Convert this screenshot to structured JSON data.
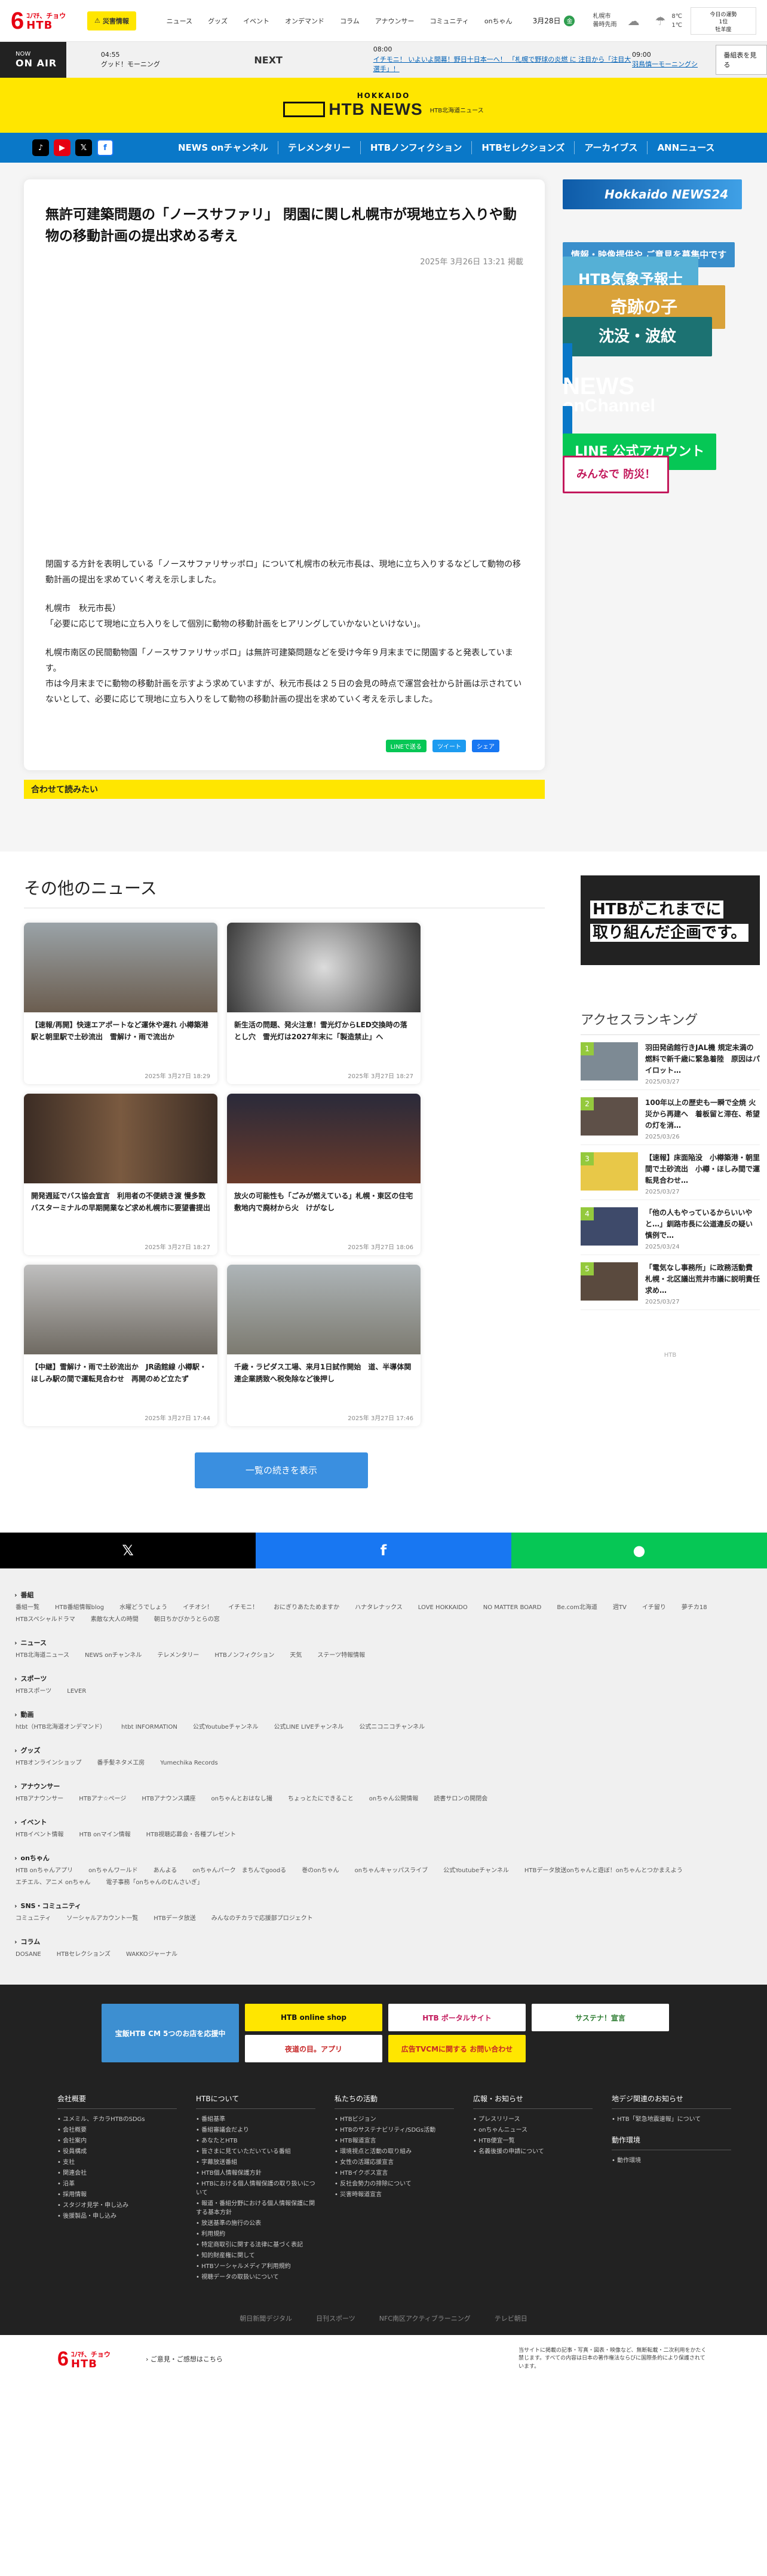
{
  "header": {
    "logo_num": "6",
    "logo_top": "ｺﾉﾏﾁ、チョウ",
    "logo_brand": "HTB",
    "disaster_label": "災害情報",
    "nav": [
      "ニュース",
      "グッズ",
      "イベント",
      "オンデマンド",
      "コラム",
      "アナウンサー",
      "コミュニティ",
      "onちゃん"
    ],
    "date": "3月28日",
    "date_badge": "金",
    "weather_line1": "札幌市",
    "weather_line2": "曇時先雨",
    "temp_line1": "8℃",
    "temp_line2": "1℃",
    "fortune_line1": "今日の運勢",
    "fortune_line2": "1位",
    "fortune_line3": "牡羊座"
  },
  "onair": {
    "label_top": "NOW",
    "label": "ON AIR",
    "now_time": "04:55",
    "now_title": "グッド！モーニング",
    "next_label": "NEXT",
    "next_time": "08:00",
    "next_title": "イチモニ！ いよいよ開幕！野日十日本一へ！ 「札幌で野球の炎燃 に 注目から「注目大選手」！",
    "next2_time": "09:00",
    "next2_title": "羽鳥慎一モーニングシ",
    "program_btn": "番組表を見る"
  },
  "newsbrand": {
    "hokkaido": "HOKKAIDO",
    "title": "HTB NEWS",
    "sub": "HTB北海道ニュース"
  },
  "mainnav": [
    "NEWS onチャンネル",
    "テレメンタリー",
    "HTBノンフィクション",
    "HTBセレクションズ",
    "アーカイブス",
    "ANNニュース"
  ],
  "article": {
    "title": "無許可建築問題の「ノースサファリ」 閉園に関し札幌市が現地立ち入りや動物の移動計画の提出求める考え",
    "pubdate": "2025年 3月26日 13:21 掲載",
    "p1": "閉園する方針を表明している「ノースサファリサッポロ」について札幌市の秋元市長は、現地に立ち入りするなどして動物の移動計画の提出を求めていく考えを示しました。",
    "p2a": "札幌市　秋元市長）",
    "p2b": "「必要に応じて現地に立ち入りをして個別に動物の移動計画をヒアリングしていかないといけない」。",
    "p3": "札幌市南区の民間動物園「ノースサファリサッポロ」は無許可建築問題などを受け今年９月末までに閉園すると発表しています。",
    "p4": "市は今月末までに動物の移動計画を示すよう求めていますが、秋元市長は２５日の会見の時点で運営会社から計画は示されていないとして、必要に応じて現地に立ち入りをして動物の移動計画の提出を求めていく考えを示しました。",
    "share_line": "LINEで送る",
    "share_tw": "ツイート",
    "share_fb": "シェア",
    "also_read": "合わせて読みたい"
  },
  "side": {
    "news24": "Hokkaido NEWS24",
    "info": "情報・映像提供や ご意見を募集中です",
    "kisho": "HTB気象予報士",
    "kiseki": "奇跡の子",
    "chinmoku": "沈没・波紋",
    "onch_a": "NEWS",
    "onch_b": "onChannel",
    "line": "LINE 公式アカウント",
    "bousai": "みんなで 防災！"
  },
  "other": {
    "heading": "その他のニュース",
    "cards": [
      {
        "caption": "【速報/再開】快速エアポートなど運休や遅れ 小樽築港駅と朝里駅で土砂流出　雪解け・雨で流出か",
        "date": "2025年 3月27日 18:29"
      },
      {
        "caption": "新生活の問題、発火注意！雪光灯からLED交換時の落とし穴　雪光灯は2027年末に「製造禁止」へ",
        "date": "2025年 3月27日 18:27"
      },
      {
        "caption": "開発週延でバス協会宣言　利用者の不便続き渡 慢多数　バスターミナルの早期開業など求め札幌市に要望書提出",
        "date": "2025年 3月27日 18:27"
      },
      {
        "caption": "放火の可能性も「ごみが燃えている」札幌・東区の住宅敷地内で廃材から火　けがなし",
        "date": "2025年 3月27日 18:06"
      },
      {
        "caption": "【中継】雪解け・雨で土砂流出か　JR函館線 小樽駅・ほしみ駅の間で運転見合わせ　再開のめど立たず",
        "date": "2025年 3月27日 17:44"
      },
      {
        "caption": "千歳・ラピダス工場、来月1日試作開始　道、半導体関連企業誘致へ税免除など後押し",
        "date": "2025年 3月27日 17:46"
      }
    ],
    "more": "一覧の続きを表示",
    "ad_line1": "HTBがこれまでに",
    "ad_line2": "取り組んだ企画です。",
    "rank_title": "アクセスランキング",
    "ranks": [
      {
        "num": "1",
        "title": "羽田発函館行きJAL機 規定未満の燃料で新千歳に緊急着陸　原因はパイロット…",
        "date": "2025/03/27"
      },
      {
        "num": "2",
        "title": "100年以上の歴史も一瞬で全焼 火災から再建へ　着板留と滞在、希望の灯を消…",
        "date": "2025/03/26"
      },
      {
        "num": "3",
        "title": "【速報】床面陥没　小樽築港・朝里間で土砂流出　小樽・ほしみ間で運転見合わせ…",
        "date": "2025/03/27"
      },
      {
        "num": "4",
        "title": "「他の人もやっているからいいやと…」釧路市長に公道違反の疑い　慎例で…",
        "date": "2025/03/24"
      },
      {
        "num": "5",
        "title": "「電気なし事務所」に政務活動費　札幌・北区議出荒井市議に説明責任求め…",
        "date": "2025/03/27"
      }
    ],
    "rank_foot": "HTB"
  },
  "sharebar": {
    "x": "𝕏",
    "f": "f",
    "l": "●"
  },
  "sitemap": [
    {
      "title": "番組",
      "links": [
        "番組一覧",
        "HTB番組情報blog",
        "水曜どうでしょう",
        "イチオシ！",
        "イチモニ！",
        "おにぎりあたためますか",
        "ハナタレナックス",
        "LOVE HOKKAIDO",
        "NO MATTER BOARD",
        "Be.com北海道",
        "週TV",
        "イチ留り",
        "夢チカ18",
        "HTBスペシャルドラマ",
        "素敵な大人の時間",
        "朝日ちかびかうとらの窓"
      ]
    },
    {
      "title": "ニュース",
      "links": [
        "HTB北海道ニュース",
        "NEWS onチャンネル",
        "テレメンタリー",
        "HTBノンフィクション",
        "天気",
        "ステーツ特報情報"
      ]
    },
    {
      "title": "スポーツ",
      "links": [
        "HTBスポーツ",
        "LEVER"
      ]
    },
    {
      "title": "動画",
      "links": [
        "htbt（HTB北海道オンデマンド）",
        "htbt INFORMATION",
        "公式Youtubeチャンネル",
        "公式LINE LIVEチャンネル",
        "公式ニコニコチャンネル"
      ]
    },
    {
      "title": "グッズ",
      "links": [
        "HTBオンラインショップ",
        "番手髪ネタメ工房",
        "Yumechika Records"
      ]
    },
    {
      "title": "アナウンサー",
      "links": [
        "HTBアナウンサー",
        "HTBアナ☆ページ",
        "HTBアナウンス講座",
        "onちゃんとおはなし撮",
        "ちょっとたにできること",
        "onちゃん公開情報",
        "読書サロンの開閉会"
      ]
    },
    {
      "title": "イベント",
      "links": [
        "HTBイベント情報",
        "HTB onマイン情報",
        "HTB視聴応募会・各種プレゼント"
      ]
    },
    {
      "title": "onちゃん",
      "links": [
        "HTB onちゃんアプリ",
        "onちゃんワールド",
        "あんよる",
        "onちゃんパーク　まちんでgoodる",
        "巻のonちゃん",
        "onちゃんキャッパスライブ",
        "公式Youtubeチャンネル",
        "HTBデータ放送onちゃんと遊ぼ！onちゃんとつかまえよう",
        "エチエル、アニメ onちゃん",
        "電子事務「onちゃんのむんさいぎ」"
      ]
    },
    {
      "title": "SNS・コミュニティ",
      "links": [
        "コミュニティ",
        "ソーシャルアカウント一覧",
        "HTBデータ放送",
        "みんなのチカラで応援部プロジェクト"
      ]
    },
    {
      "title": "コラム",
      "links": [
        "DOSANE",
        "HTBセレクションズ",
        "WAKKOジャーナル"
      ]
    }
  ],
  "footer": {
    "banners": [
      "宝飯HTB CM 5つのお店を応援中",
      "HTB online shop",
      "HTB ポータルサイト",
      "サステナ！宣言",
      "夜道の目。アプリ",
      "広告TVCMに関する お問い合わせ"
    ],
    "cols": [
      {
        "title": "会社概要",
        "items": [
          "ユメミル、チカラHTBのSDGs",
          "会社概要",
          "会社案内",
          "役員構成",
          "支社",
          "関連会社",
          "沿革",
          "採用情報",
          "スタジオ見学・申し込み",
          "後援製品・申し込み"
        ]
      },
      {
        "title": "HTBについて",
        "items": [
          "番組基準",
          "番組審議会だより",
          "あなたとHTB",
          "皆さまに見ていただいている番組",
          "字幕放送番組",
          "HTB個人情報保護方針",
          "HTBにおける個人情報保護の取り扱いについて",
          "報道・番組分野における個人情報保護に関する基本方針",
          "放送基準の施行の公表",
          "利用規約",
          "特定商取引に関する法律に基づく表記",
          "知的財産権に関して",
          "HTBソーシャルメディア利用規約",
          "視聴データの取扱いについて"
        ]
      },
      {
        "title": "私たちの活動",
        "items": [
          "HTBビジョン",
          "HTBのサステナビリティ/SDGs活動",
          "HTB報道宣言",
          "環境視点と活動の取り組み",
          "女性の活躍応援宣言",
          "HTBイクボス宣言",
          "反社会勢力の排除について",
          "災害時報道宣言"
        ]
      },
      {
        "title": "広報・お知らせ",
        "items": [
          "プレスリリース",
          "onちゃんニュース",
          "HTB便宜一覧",
          "名義後援の申請について"
        ]
      },
      {
        "title": "地デジ関連のお知らせ",
        "items": [
          "HTB「緊急地震速報」について"
        ],
        "title2": "動作環境",
        "items2": [
          "動作環境"
        ]
      }
    ],
    "links": [
      "朝日新聞デジタル",
      "日刊スポーツ",
      "NFC南区アクティブラーニング",
      "テレビ朝日"
    ],
    "contact": "ご意見・ご感想はこちら",
    "copyright": "当サイトに掲載の記事・写真・図表・映像など、無断転載・二次利用をかたく禁じます。すべての内容は日本の著作権法ならびに国際条約により保護されています。"
  }
}
